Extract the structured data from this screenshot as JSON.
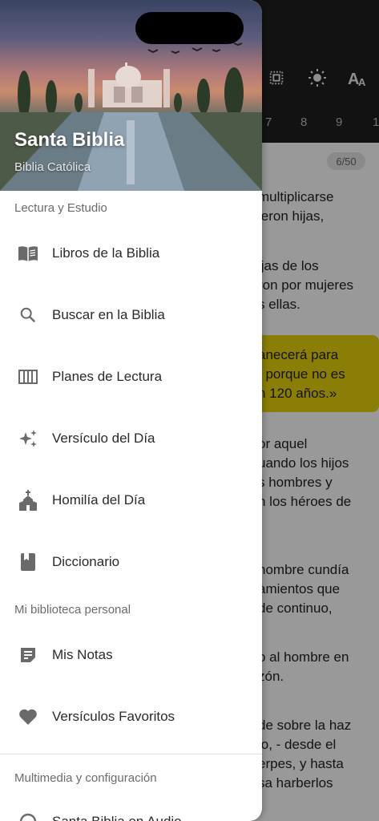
{
  "background": {
    "toolbar_icons": [
      "fullscreen-icon",
      "brightness-icon",
      "text-size-icon"
    ],
    "chapter_numbers": [
      "7",
      "8",
      "9",
      "1"
    ],
    "page_indicator": "6/50",
    "verse_lines": [
      "multiplicarse",
      "ieron hijas,",
      "ijas de los",
      "ron por mujeres",
      "s ellas.",
      "anecerá para",
      ", porque no es",
      "n 120 años.»",
      "or aquel",
      "uando los hijos",
      "s hombres y",
      "n los héroes de",
      ".",
      "hombre cundía",
      "amientos que",
      "de continuo,",
      "o al hombre en",
      "zón.",
      "de sobre la haz",
      "lo, - desde el",
      "erpes, y hasta",
      "sa harberlos"
    ],
    "highlight_color": "#e8d30b"
  },
  "drawer": {
    "title": "Santa Biblia",
    "subtitle": "Biblia Católica",
    "sections": [
      {
        "label": "Lectura y Estudio",
        "items": [
          {
            "label": "Libros de la Biblia",
            "icon": "open-book-icon"
          },
          {
            "label": "Buscar en la Biblia",
            "icon": "search-icon"
          },
          {
            "label": "Planes de Lectura",
            "icon": "calendar-view-icon"
          },
          {
            "label": "Versículo del Día",
            "icon": "sparkles-icon"
          },
          {
            "label": "Homilía del Día",
            "icon": "church-icon"
          },
          {
            "label": "Diccionario",
            "icon": "book-icon"
          }
        ]
      },
      {
        "label": "Mi biblioteca personal",
        "items": [
          {
            "label": "Mis Notas",
            "icon": "note-icon"
          },
          {
            "label": "Versículos Favoritos",
            "icon": "heart-icon"
          }
        ]
      },
      {
        "label": "Multimedia y configuración",
        "items": [
          {
            "label": "Santa Biblia en Audio",
            "icon": "headphones-icon"
          }
        ]
      }
    ]
  }
}
